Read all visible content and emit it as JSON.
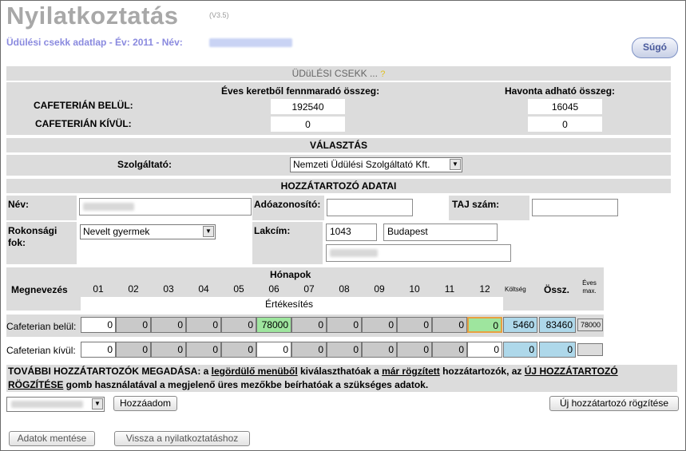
{
  "header": {
    "title": "Nyilatkoztatás",
    "version": "(V3.5)",
    "subtitle": "Üdülési csekk adatlap - Év: 2011 - Név:",
    "help_label": "Súgó"
  },
  "csekk": {
    "section_title": "ÜDüLÉSI CSEKK ...",
    "help_mark": "?",
    "col_annual": "Éves keretből fennmaradó összeg:",
    "col_monthly": "Havonta adható összeg:",
    "row_inside": "CAFETERIÁN BELÜL:",
    "row_outside": "CAFETERIÁN KÍVÜL:",
    "inside_annual": "192540",
    "inside_monthly": "16045",
    "outside_annual": "0",
    "outside_monthly": "0"
  },
  "valasztas": {
    "section_title": "VÁLASZTÁS",
    "provider_label": "Szolgáltató:",
    "provider_value": "Nemzeti Üdülési Szolgáltató Kft."
  },
  "hozzatartozo": {
    "section_title": "HOZZÁTARTOZÓ ADATAI",
    "name_label": "Név:",
    "tax_label": "Adóazonosító:",
    "taj_label": "TAJ szám:",
    "relation_label_1": "Rokonsági",
    "relation_label_2": "fok:",
    "relation_value": "Nevelt gyermek",
    "address_label": "Lakcím:",
    "zip": "1043",
    "city": "Budapest"
  },
  "months": {
    "group_label": "Hónapok",
    "name_header": "Megnevezés",
    "labels": [
      "01",
      "02",
      "03",
      "04",
      "05",
      "06",
      "07",
      "08",
      "09",
      "10",
      "11",
      "12"
    ],
    "cost_header": "Költség",
    "sum_header": "Össz.",
    "annual_max_1": "Éves",
    "annual_max_2": "max.",
    "sale_label": "Értékesítés",
    "rows": [
      {
        "label": "Cafeterian belül:",
        "values": [
          "0",
          "0",
          "0",
          "0",
          "0",
          "78000",
          "0",
          "0",
          "0",
          "0",
          "0",
          "0"
        ],
        "cost": "5460",
        "sum": "83460",
        "max": "78000"
      },
      {
        "label": "Cafeterian kívül:",
        "values": [
          "0",
          "0",
          "0",
          "0",
          "0",
          "0",
          "0",
          "0",
          "0",
          "0",
          "0",
          "0"
        ],
        "cost": "0",
        "sum": "0",
        "max": ""
      }
    ]
  },
  "note": {
    "p1": "TOVÁBBI HOZZÁTARTOZÓK MEGADÁSA: a ",
    "u1": "legördülő menüből",
    "p2": " kiválaszthatóak a ",
    "u2": "már rögzített",
    "p3": " hozzátartozók, az ",
    "u3": "ÚJ HOZZÁTARTOZÓ RÖGZÍTÉSE",
    "p4": " gomb használatával a megjelenő üres mezőkbe beírhatóak a szükséges adatok."
  },
  "buttons": {
    "add": "Hozzáadom",
    "new_relative": "Új hozzátartozó rögzítése",
    "save": "Adatok mentése",
    "back": "Vissza a nyilatkoztatáshoz"
  },
  "colors": {
    "section_gray": "#dcdcdc",
    "cell_gray": "#c9c9c9",
    "highlight_green": "#9ee59e",
    "highlight_blue": "#aed8ea",
    "subtitle_blue": "#8a8adf"
  }
}
